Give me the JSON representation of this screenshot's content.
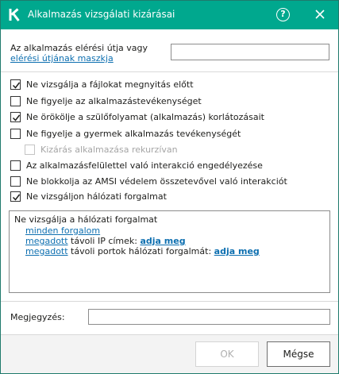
{
  "window": {
    "title": "Alkalmazás vizsgálati kizárásai",
    "accent_color": "#00a88e"
  },
  "path": {
    "label_prefix": "Az alkalmazás elérési útja vagy ",
    "label_link": "elérési útjának maszkja",
    "value": ""
  },
  "options": [
    {
      "label": "Ne vizsgálja a fájlokat megnyitás előtt",
      "checked": true,
      "disabled": false
    },
    {
      "label": "Ne figyelje az alkalmazástevékenységet",
      "checked": false,
      "disabled": false
    },
    {
      "label": "Ne örökölje a szülőfolyamat (alkalmazás) korlátozásait",
      "checked": true,
      "disabled": false
    },
    {
      "label": "Ne figyelje a gyermek alkalmazás tevékenységét",
      "checked": false,
      "disabled": false
    },
    {
      "label": "Kizárás alkalmazása rekurzívan",
      "checked": false,
      "disabled": true
    },
    {
      "label": "Az alkalmazásfelülettel való interakció engedélyezése",
      "checked": false,
      "disabled": false
    },
    {
      "label": "Ne blokkolja az AMSI védelem összetevővel való interakciót",
      "checked": false,
      "disabled": false
    },
    {
      "label": "Ne vizsgáljon hálózati forgalmat",
      "checked": true,
      "disabled": false
    }
  ],
  "description": {
    "title": "Ne vizsgálja a hálózati forgalmat",
    "all_traffic": "minden forgalom",
    "ip_link": "megadott",
    "ip_text": " távoli IP címek: ",
    "ip_value_link": "adja meg",
    "port_link": "megadott",
    "port_text": " távoli portok hálózati forgalmát: ",
    "port_value_link": "adja meg"
  },
  "comment": {
    "label": "Megjegyzés:",
    "value": ""
  },
  "footer": {
    "ok_label": "OK",
    "cancel_label": "Mégse"
  }
}
